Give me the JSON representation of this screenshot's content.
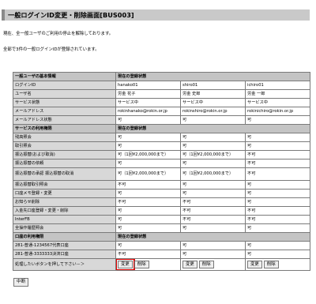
{
  "page_title": "一般ログインID変更・削除画面[BUS003]",
  "message1": "現在、全一般ユーザのご利用の停止を解除しております。",
  "message2": "全部で3件の一般ログインIDが登録されています。",
  "table": {
    "sec_basic": "一般ユーザの基本情報",
    "sec_status": "現在の登録状態",
    "rows_basic": [
      {
        "label": "ログインID",
        "values": [
          "hanako01",
          "shiro01",
          "ichiro01"
        ]
      },
      {
        "label": "ユーザ名",
        "values": [
          "労金 花子",
          "労金 史郎",
          "労金 一郎"
        ]
      },
      {
        "label": "サービス状態",
        "values": [
          "サービス中",
          "サービス中",
          "サービス中"
        ]
      },
      {
        "label": "メールアドレス",
        "values": [
          "rokinhanako@rokin.or.jp",
          "rokinshiro@rokin.or.jp",
          "rokinichiro@rokin.or.jp"
        ]
      },
      {
        "label": "メールアドレス状態",
        "values": [
          "可",
          "可",
          "可"
        ]
      }
    ],
    "sec_service": "サービスの利用権限",
    "rows_service": [
      {
        "label": "残高照会",
        "values": [
          "可",
          "可",
          "可"
        ]
      },
      {
        "label": "取引照会",
        "values": [
          "可",
          "可",
          "可"
        ]
      },
      {
        "label": "振込振替(および取消)",
        "values": [
          "可（1回¥2,000,000まで）",
          "可（1回¥2,000,000まで）",
          "不可"
        ]
      },
      {
        "label": "振込振替の依頼",
        "values": [
          "可",
          "可",
          "不可"
        ]
      },
      {
        "label": "振込振替の承認 振込振替の取消",
        "values": [
          "可（1回¥2,000,000まで）",
          "可（1回¥2,000,000まで）",
          "不可"
        ]
      },
      {
        "label": "振込振替取引照会",
        "values": [
          "不可",
          "可",
          "可"
        ]
      },
      {
        "label": "口座メモ登録・変更",
        "values": [
          "可",
          "可",
          "可"
        ]
      },
      {
        "label": "お知らせ削除",
        "values": [
          "不可",
          "不可",
          "可"
        ]
      },
      {
        "label": "入金先口座登録・変更・削除",
        "values": [
          "可",
          "不可",
          "不可"
        ]
      },
      {
        "label": "InterFB",
        "values": [
          "可",
          "不可",
          "不可"
        ]
      },
      {
        "label": "全操作履歴照会",
        "values": [
          "可",
          "可",
          "可"
        ]
      }
    ],
    "sec_account": "口座の利用権限",
    "rows_account": [
      {
        "label": "281-普通-1234567代表口座",
        "values": [
          "可",
          "可",
          "可"
        ]
      },
      {
        "label": "281-普通-3333333決済口座",
        "values": [
          "不可",
          "可",
          "可"
        ]
      }
    ],
    "action_label": "処理したいボタンを押して下さい－＞",
    "change_label": "変更",
    "delete_label": "削除"
  },
  "bottom_button": "中断"
}
